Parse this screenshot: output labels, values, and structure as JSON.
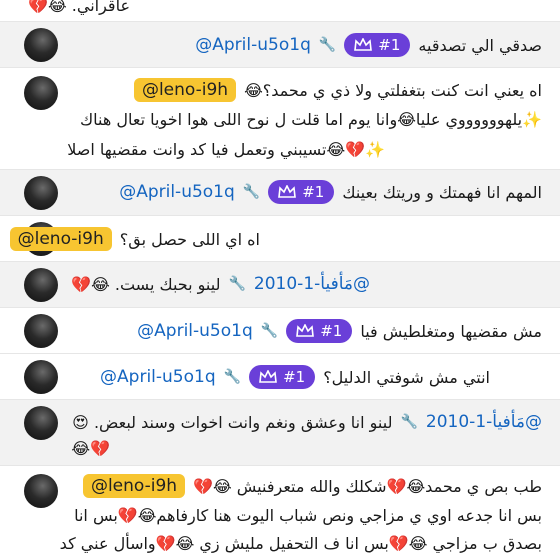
{
  "messages": [
    {
      "id": "m0",
      "handle": "",
      "handle_style": "none",
      "text": "عاقرأني. 😂💔",
      "lines": []
    },
    {
      "id": "m1",
      "handle": "@April-u5o1q",
      "handle_style": "plain",
      "rank": "#1",
      "text": "صدقي الي تصدقيه",
      "lines": []
    },
    {
      "id": "m2",
      "handle": "@leno-i9h",
      "handle_style": "yellow",
      "text": "اه يعني انت كنت بتغفلتي ولا ذي ي محمد؟😂",
      "lines": [
        "✨يلهووووووي عليا😂وانا يوم اما قلت ل نوح اللى هوا اخويا تعال هناك",
        "✨💔😂تسيبني وتعمل فيا كد وانت مقضيها اصلا"
      ]
    },
    {
      "id": "m3",
      "handle": "@April-u5o1q",
      "handle_style": "plain",
      "rank": "#1",
      "text": "المهم انا فهمتك و وريتك بعينك",
      "lines": []
    },
    {
      "id": "m4",
      "handle": "@leno-i9h",
      "handle_style": "yellow",
      "text": "اه اي اللى حصل بق؟",
      "lines": []
    },
    {
      "id": "m5",
      "handle": "@مَأفيأ-1-2010",
      "handle_style": "plain",
      "text": "لينو بحبك يست. 😂💔",
      "lines": []
    },
    {
      "id": "m6",
      "handle": "@April-u5o1q",
      "handle_style": "plain",
      "rank": "#1",
      "text": "مش مقضيها ومتغلطيش فيا",
      "lines": []
    },
    {
      "id": "m7",
      "handle": "@April-u5o1q",
      "handle_style": "plain",
      "rank": "#1",
      "text": "انتي مش شوفتي الدليل؟",
      "lines": []
    },
    {
      "id": "m8",
      "handle": "@مَأفيأ-1-2010",
      "handle_style": "plain",
      "text": "لينو انا وعشق ونغم وانت اخوات وسند لبعض. 😍",
      "lines": [
        "💔😂"
      ]
    },
    {
      "id": "m9",
      "handle": "@leno-i9h",
      "handle_style": "yellow",
      "text": "طب بص ي محمد😂💔شكلك والله متعرفنيش 😂💔",
      "lines": [
        "بس انا جدعه اوي ي مزاجي ونص شباب اليوت هنا كارفاهم😂💔بس انا",
        "بصدق ب مزاجي 😂💔بس انا ف التحفيل مليش زي 😂💔واسأل عني كد"
      ]
    }
  ]
}
